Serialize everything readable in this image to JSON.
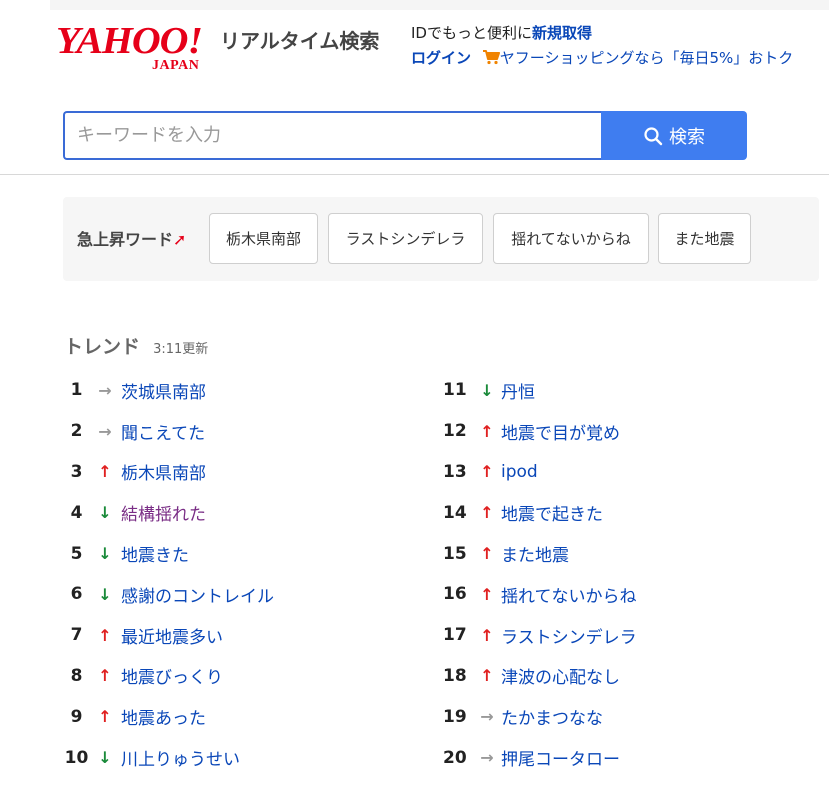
{
  "header": {
    "logo_main": "YAHOO!",
    "logo_sub": "JAPAN",
    "service_name": "リアルタイム検索",
    "promo_text": "IDでもっと便利に",
    "promo_link": "新規取得",
    "login_label": "ログイン",
    "shopping_promo": "ヤフーショッピングなら「毎日5%」おトク"
  },
  "search": {
    "placeholder": "キーワードを入力",
    "button_label": "検索"
  },
  "rising": {
    "label": "急上昇ワード",
    "chips": [
      "栃木県南部",
      "ラストシンデレラ",
      "揺れてないからね",
      "また地震"
    ]
  },
  "trend": {
    "title": "トレンド",
    "updated": "3:11更新",
    "items": [
      {
        "rank": "1",
        "dir": "same",
        "word": "茨城県南部"
      },
      {
        "rank": "2",
        "dir": "same",
        "word": "聞こえてた"
      },
      {
        "rank": "3",
        "dir": "up",
        "word": "栃木県南部"
      },
      {
        "rank": "4",
        "dir": "down",
        "word": "結構揺れた",
        "visited": true
      },
      {
        "rank": "5",
        "dir": "down",
        "word": "地震きた"
      },
      {
        "rank": "6",
        "dir": "down",
        "word": "感謝のコントレイル"
      },
      {
        "rank": "7",
        "dir": "up",
        "word": "最近地震多い"
      },
      {
        "rank": "8",
        "dir": "up",
        "word": "地震びっくり"
      },
      {
        "rank": "9",
        "dir": "up",
        "word": "地震あった"
      },
      {
        "rank": "10",
        "dir": "down",
        "word": "川上りゅうせい"
      },
      {
        "rank": "11",
        "dir": "down",
        "word": "丹恒"
      },
      {
        "rank": "12",
        "dir": "up",
        "word": "地震で目が覚め"
      },
      {
        "rank": "13",
        "dir": "up",
        "word": "ipod"
      },
      {
        "rank": "14",
        "dir": "up",
        "word": "地震で起きた"
      },
      {
        "rank": "15",
        "dir": "up",
        "word": "また地震"
      },
      {
        "rank": "16",
        "dir": "up",
        "word": "揺れてないからね"
      },
      {
        "rank": "17",
        "dir": "up",
        "word": "ラストシンデレラ"
      },
      {
        "rank": "18",
        "dir": "up",
        "word": "津波の心配なし"
      },
      {
        "rank": "19",
        "dir": "same",
        "word": "たかまつなな"
      },
      {
        "rank": "20",
        "dir": "same",
        "word": "押尾コータロー"
      }
    ]
  },
  "colors": {
    "brand_red": "#e60019",
    "link_blue": "#0a47b8",
    "search_button": "#3f7df0",
    "up": "#e02020",
    "down": "#1a8a3a",
    "same": "#999999"
  },
  "icons": {
    "up": "arrow-up-icon",
    "down": "arrow-down-icon",
    "same": "arrow-right-icon",
    "search": "search-icon",
    "cart": "cart-icon"
  }
}
